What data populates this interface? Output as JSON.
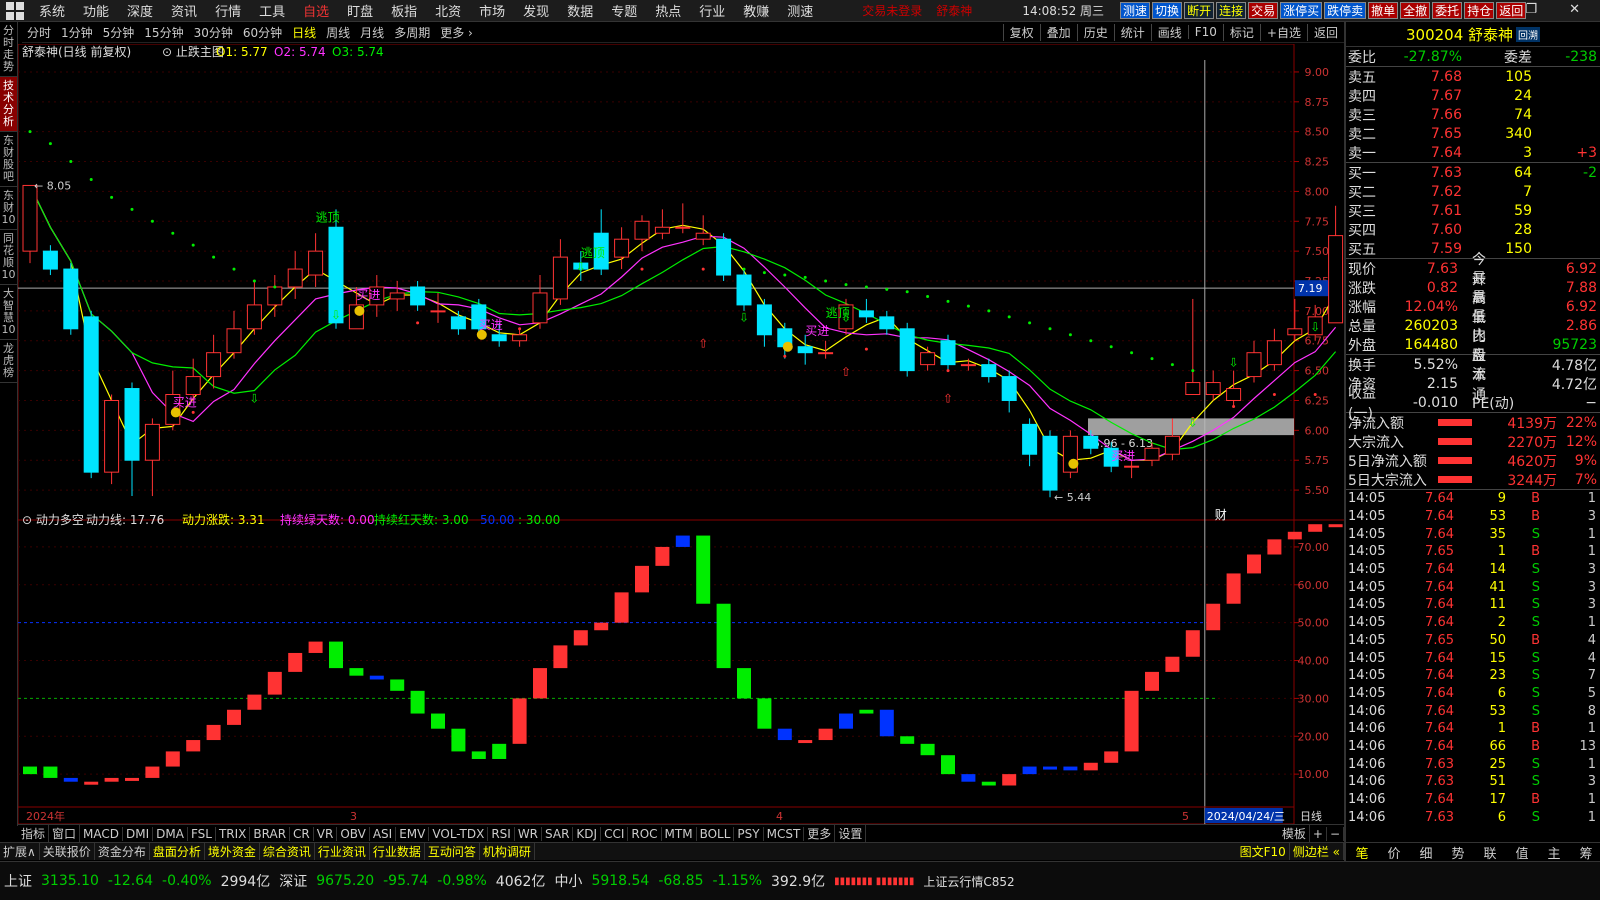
{
  "menu": {
    "items": [
      "系统",
      "功能",
      "深度",
      "资讯",
      "行情",
      "工具",
      "自选",
      "盯盘",
      "板指",
      "北资",
      "市场",
      "发现",
      "数据",
      "专题",
      "热点",
      "行业",
      "教赚",
      "测速"
    ],
    "notice": "交易未登录",
    "user": "舒泰神",
    "clock": "14:08:52 周三",
    "buttons": [
      "测速",
      "切换",
      "断开",
      "连接",
      "交易",
      "涨停买",
      "跌停卖",
      "撤单",
      "全撤",
      "委托",
      "持仓",
      "返回"
    ],
    "window": "— ❐ ✕"
  },
  "toolbar": {
    "periods": [
      "分时",
      "1分钟",
      "5分钟",
      "15分钟",
      "30分钟",
      "60分钟",
      "日线",
      "周线",
      "月线",
      "多周期",
      "更多 ›"
    ],
    "right": [
      "复权",
      "叠加",
      "历史",
      "统计",
      "画线",
      "F10",
      "标记",
      "+自选",
      "返回"
    ]
  },
  "left_tabs": [
    "分时走势",
    "技术分析",
    "东财股吧",
    "东财10",
    "同花顺10",
    "大智慧10",
    "龙虎榜"
  ],
  "main_title": {
    "name": "舒泰神(日线 前复权)",
    "indicator": "止跌主图",
    "o1": "O1: 5.77",
    "o2": "O2: 5.74",
    "o3": "O3: 5.74"
  },
  "sub_title": {
    "name": "动力多空",
    "l1": "动力线: 17.76",
    "l2": "动力涨跌: 3.31",
    "l3": "持续绿天数: 0.00",
    "l4": "持续红天数: 3.00",
    "l5": "50.00",
    "l6": ": 30.00"
  },
  "bottom_tabs": [
    "指标",
    "窗口",
    "MACD",
    "DMI",
    "DMA",
    "FSL",
    "TRIX",
    "BRAR",
    "CR",
    "VR",
    "OBV",
    "ASI",
    "EMV",
    "VOL-TDX",
    "RSI",
    "WR",
    "SAR",
    "KDJ",
    "CCI",
    "ROC",
    "MTM",
    "BOLL",
    "PSY",
    "MCST",
    "更多",
    "设置",
    "模板",
    "+",
    "−"
  ],
  "ext_tabs": [
    "扩展∧",
    "关联报价",
    "资金分布",
    "盘面分析",
    "境外资金",
    "综合资讯",
    "行业资讯",
    "行业数据",
    "互动问答",
    "机构调研",
    "图文F10",
    "侧边栏 «"
  ],
  "status": {
    "sh_name": "上证",
    "sh": "3135.10",
    "sh_chg": "-12.64",
    "sh_pct": "-0.40%",
    "sh_amt": "2994亿",
    "sz_name": "深证",
    "sz": "9675.20",
    "sz_chg": "-95.74",
    "sz_pct": "-0.98%",
    "sz_amt": "4062亿",
    "zx_name": "中小",
    "zx": "5918.54",
    "zx_chg": "-68.85",
    "zx_pct": "-1.15%",
    "zx_amt": "392.9亿",
    "cloud": "上证云行情C852"
  },
  "quote": {
    "code": "300204 舒泰神",
    "badge": "回溯",
    "wb_label": "委比",
    "wb": "-27.87%",
    "wc_label": "委差",
    "wc": "-238",
    "asks": [
      {
        "l": "卖五",
        "p": "7.68",
        "v": "105",
        "c": ""
      },
      {
        "l": "卖四",
        "p": "7.67",
        "v": "24",
        "c": ""
      },
      {
        "l": "卖三",
        "p": "7.66",
        "v": "74",
        "c": ""
      },
      {
        "l": "卖二",
        "p": "7.65",
        "v": "340",
        "c": ""
      },
      {
        "l": "卖一",
        "p": "7.64",
        "v": "3",
        "c": "+3"
      }
    ],
    "bids": [
      {
        "l": "买一",
        "p": "7.63",
        "v": "64",
        "c": "-2"
      },
      {
        "l": "买二",
        "p": "7.62",
        "v": "7",
        "c": ""
      },
      {
        "l": "买三",
        "p": "7.61",
        "v": "59",
        "c": ""
      },
      {
        "l": "买四",
        "p": "7.60",
        "v": "28",
        "c": ""
      },
      {
        "l": "买五",
        "p": "7.59",
        "v": "150",
        "c": ""
      }
    ],
    "stats": [
      [
        "现价",
        "7.63",
        "今开",
        "6.92"
      ],
      [
        "涨跌",
        "0.82",
        "最高",
        "7.88"
      ],
      [
        "涨幅",
        "12.04%",
        "最低",
        "6.92"
      ],
      [
        "总量",
        "260203",
        "量比",
        "2.86"
      ],
      [
        "外盘",
        "164480",
        "内盘",
        "95723"
      ]
    ],
    "stats2": [
      [
        "换手",
        "5.52%",
        "股本",
        "4.78亿"
      ],
      [
        "净资",
        "2.15",
        "流通",
        "4.72亿"
      ],
      [
        "收益(一)",
        "-0.010",
        "PE(动)",
        "−"
      ]
    ],
    "flows": [
      [
        "净流入额",
        "4139万",
        "22%"
      ],
      [
        "大宗流入",
        "2270万",
        "12%"
      ],
      [
        "5日净流入额",
        "4620万",
        "9%"
      ],
      [
        "5日大宗流入",
        "3244万",
        "7%"
      ]
    ],
    "ticks": [
      [
        "14:05",
        "7.64",
        "9",
        "B",
        "1"
      ],
      [
        "14:05",
        "7.64",
        "53",
        "B",
        "3"
      ],
      [
        "14:05",
        "7.64",
        "35",
        "S",
        "1"
      ],
      [
        "14:05",
        "7.65",
        "1",
        "B",
        "1"
      ],
      [
        "14:05",
        "7.64",
        "14",
        "S",
        "3"
      ],
      [
        "14:05",
        "7.64",
        "41",
        "S",
        "3"
      ],
      [
        "14:05",
        "7.64",
        "11",
        "S",
        "3"
      ],
      [
        "14:05",
        "7.64",
        "2",
        "S",
        "1"
      ],
      [
        "14:05",
        "7.65",
        "50",
        "B",
        "4"
      ],
      [
        "14:05",
        "7.64",
        "15",
        "S",
        "4"
      ],
      [
        "14:05",
        "7.64",
        "23",
        "S",
        "7"
      ],
      [
        "14:05",
        "7.64",
        "6",
        "S",
        "5"
      ],
      [
        "14:06",
        "7.64",
        "53",
        "S",
        "8"
      ],
      [
        "14:06",
        "7.64",
        "1",
        "B",
        "1"
      ],
      [
        "14:06",
        "7.64",
        "66",
        "B",
        "13"
      ],
      [
        "14:06",
        "7.63",
        "25",
        "S",
        "1"
      ],
      [
        "14:06",
        "7.63",
        "51",
        "S",
        "3"
      ],
      [
        "14:06",
        "7.64",
        "17",
        "B",
        "1"
      ],
      [
        "14:06",
        "7.63",
        "6",
        "S",
        "1"
      ]
    ],
    "rtabs": [
      "笔",
      "价",
      "细",
      "势",
      "联",
      "值",
      "主",
      "筹"
    ]
  },
  "colors": {
    "up": "#ff3333",
    "down": "#00e5ff",
    "green": "#00ee00",
    "yellow": "#ffff00",
    "magenta": "#ff33ff",
    "blue": "#0033ff"
  },
  "chart_data": {
    "type": "candlestick",
    "price_axis": {
      "ylim": [
        5.35,
        9.1
      ],
      "ticks": [
        5.5,
        5.75,
        6.0,
        6.25,
        6.5,
        6.75,
        7.0,
        7.25,
        7.5,
        7.75,
        8.0,
        8.25,
        8.5,
        8.75,
        9.0
      ],
      "cursor_value": "7.19"
    },
    "time_axis": {
      "labels": [
        "2024年",
        "3",
        "4",
        "2024/04/24/三",
        "5",
        "日线"
      ]
    },
    "candles": [
      [
        7.5,
        8.05,
        8.05,
        7.4
      ],
      [
        7.5,
        7.35,
        7.55,
        7.3
      ],
      [
        7.35,
        6.85,
        7.4,
        6.8
      ],
      [
        6.95,
        5.65,
        7.0,
        5.6
      ],
      [
        5.65,
        6.25,
        6.3,
        5.55
      ],
      [
        6.35,
        5.75,
        6.4,
        5.45
      ],
      [
        5.75,
        6.05,
        6.1,
        5.45
      ],
      [
        6.05,
        6.3,
        6.5,
        6.0
      ],
      [
        6.3,
        6.45,
        6.6,
        6.25
      ],
      [
        6.45,
        6.65,
        6.8,
        6.35
      ],
      [
        6.65,
        6.85,
        7.0,
        6.6
      ],
      [
        6.85,
        7.05,
        7.25,
        6.8
      ],
      [
        7.05,
        7.2,
        7.3,
        6.95
      ],
      [
        7.2,
        7.35,
        7.5,
        7.1
      ],
      [
        7.3,
        7.5,
        7.65,
        7.2
      ],
      [
        7.7,
        6.9,
        7.85,
        6.85
      ],
      [
        6.85,
        7.05,
        7.2,
        6.85
      ],
      [
        7.05,
        7.2,
        7.3,
        6.95
      ],
      [
        7.1,
        7.15,
        7.25,
        7.0
      ],
      [
        7.2,
        7.05,
        7.25,
        7.0
      ],
      [
        7.0,
        7.0,
        7.15,
        6.9
      ],
      [
        6.95,
        6.85,
        7.0,
        6.8
      ],
      [
        7.05,
        6.85,
        7.1,
        6.8
      ],
      [
        6.8,
        6.75,
        6.9,
        6.7
      ],
      [
        6.75,
        6.8,
        6.85,
        6.7
      ],
      [
        6.9,
        7.15,
        7.3,
        6.85
      ],
      [
        7.1,
        7.45,
        7.6,
        7.05
      ],
      [
        7.4,
        7.35,
        7.5,
        7.25
      ],
      [
        7.65,
        7.35,
        7.85,
        7.3
      ],
      [
        7.45,
        7.6,
        7.7,
        7.35
      ],
      [
        7.6,
        7.75,
        7.8,
        7.5
      ],
      [
        7.65,
        7.7,
        7.85,
        7.6
      ],
      [
        7.7,
        7.7,
        7.9,
        7.65
      ],
      [
        7.6,
        7.65,
        7.8,
        7.55
      ],
      [
        7.6,
        7.3,
        7.65,
        7.25
      ],
      [
        7.3,
        7.05,
        7.35,
        7.0
      ],
      [
        7.05,
        6.8,
        7.1,
        6.7
      ],
      [
        6.85,
        6.7,
        6.9,
        6.6
      ],
      [
        6.7,
        6.65,
        6.8,
        6.55
      ],
      [
        6.65,
        6.65,
        6.75,
        6.6
      ],
      [
        6.85,
        7.05,
        7.1,
        6.8
      ],
      [
        7.0,
        6.95,
        7.1,
        6.9
      ],
      [
        6.95,
        6.85,
        7.0,
        6.8
      ],
      [
        6.85,
        6.5,
        6.9,
        6.45
      ],
      [
        6.55,
        6.65,
        6.7,
        6.5
      ],
      [
        6.75,
        6.55,
        6.8,
        6.5
      ],
      [
        6.55,
        6.55,
        6.6,
        6.5
      ],
      [
        6.55,
        6.45,
        6.6,
        6.4
      ],
      [
        6.45,
        6.25,
        6.5,
        6.15
      ],
      [
        6.05,
        5.8,
        6.1,
        5.7
      ],
      [
        5.95,
        5.5,
        6.0,
        5.44
      ],
      [
        5.65,
        5.95,
        6.0,
        5.6
      ],
      [
        5.95,
        5.85,
        6.0,
        5.8
      ],
      [
        5.85,
        5.7,
        5.9,
        5.65
      ],
      [
        5.7,
        5.7,
        5.75,
        5.6
      ],
      [
        5.75,
        5.85,
        5.9,
        5.7
      ],
      [
        5.8,
        5.95,
        6.1,
        5.75
      ],
      [
        6.3,
        6.4,
        7.1,
        6.3
      ],
      [
        6.3,
        6.4,
        6.5,
        6.25
      ],
      [
        6.25,
        6.35,
        6.5,
        6.2
      ],
      [
        6.45,
        6.65,
        6.75,
        6.4
      ],
      [
        6.55,
        6.75,
        6.85,
        6.5
      ],
      [
        6.8,
        6.85,
        7.1,
        6.75
      ],
      [
        6.8,
        6.95,
        7.05,
        6.75
      ],
      [
        6.9,
        7.63,
        7.88,
        6.92
      ]
    ],
    "sar": [
      8.5,
      8.4,
      8.25,
      8.1,
      7.95,
      7.85,
      7.75,
      7.65,
      7.55,
      7.45,
      7.35,
      7.25,
      7.2,
      null,
      null,
      null,
      null,
      null,
      null,
      null,
      null,
      null,
      null,
      null,
      null,
      null,
      null,
      null,
      null,
      null,
      null,
      null,
      null,
      null,
      null,
      7.35,
      7.32,
      7.3,
      7.28,
      7.25,
      7.22,
      7.2,
      7.18,
      7.16,
      7.12,
      7.08,
      7.04,
      7.0,
      6.95,
      6.9,
      6.85,
      6.8,
      6.75,
      6.7,
      6.65,
      6.6,
      6.55,
      6.5,
      null,
      null,
      null,
      null,
      null,
      null,
      null
    ],
    "annotations": [
      "逃顶",
      "买进",
      "8.05",
      "5.44",
      "5.96 - 6.13",
      "财"
    ],
    "sub": {
      "ylim": [
        0,
        75
      ],
      "ticks": [
        10,
        20,
        30,
        40,
        50,
        60,
        70
      ],
      "levels": [
        50,
        30
      ],
      "values": [
        12,
        9,
        8,
        8,
        9,
        9,
        12,
        16,
        19,
        23,
        27,
        31,
        37,
        42,
        45,
        38,
        36,
        35,
        32,
        26,
        22,
        16,
        14,
        18,
        30,
        38,
        44,
        48,
        50,
        58,
        65,
        70,
        73,
        55,
        38,
        30,
        22,
        19,
        19,
        22,
        26,
        27,
        20,
        18,
        15,
        10,
        8,
        7,
        10,
        12,
        12,
        11,
        13,
        16,
        32,
        37,
        41,
        48,
        55,
        63,
        68,
        72,
        74,
        76,
        76
      ],
      "colors": [
        "g",
        "g",
        "b",
        "r",
        "r",
        "r",
        "r",
        "r",
        "r",
        "r",
        "r",
        "r",
        "r",
        "r",
        "r",
        "g",
        "g",
        "b",
        "g",
        "g",
        "g",
        "g",
        "g",
        "g",
        "r",
        "r",
        "r",
        "r",
        "r",
        "r",
        "r",
        "r",
        "b",
        "g",
        "g",
        "g",
        "g",
        "b",
        "r",
        "r",
        "b",
        "g",
        "b",
        "g",
        "g",
        "g",
        "b",
        "g",
        "r",
        "b",
        "b",
        "b",
        "r",
        "r",
        "r",
        "r",
        "r",
        "r",
        "r",
        "r",
        "r",
        "r",
        "r",
        "r",
        "r"
      ]
    }
  }
}
